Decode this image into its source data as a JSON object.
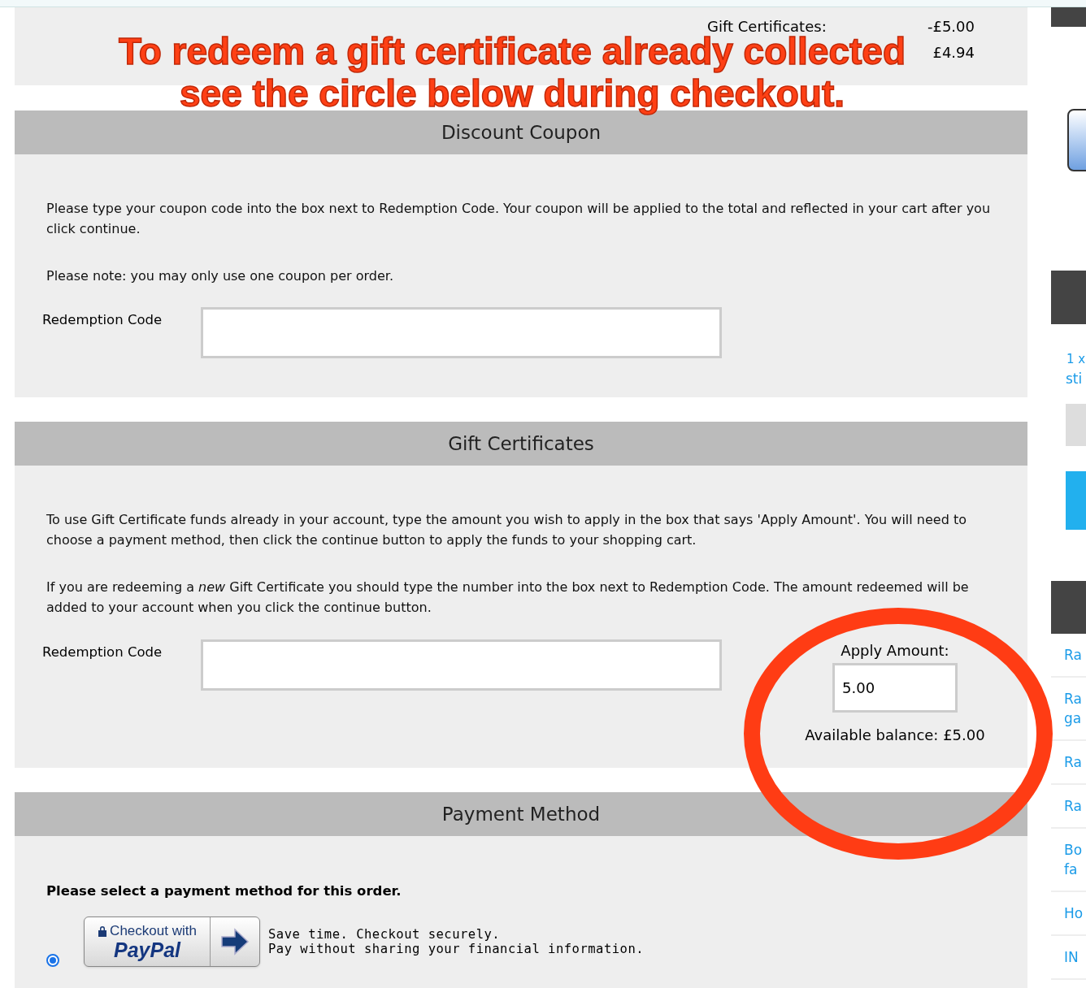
{
  "summary": [
    {
      "label": "Gift Certificates:",
      "value": "-£5.00"
    },
    {
      "value": "£4.94"
    }
  ],
  "annotation": {
    "lines": [
      "To redeem a gift certificate already collected",
      "see the circle below during checkout."
    ]
  },
  "coupon": {
    "title": "Discount Coupon",
    "paragraphs": [
      "Please type your coupon code into the box next to Redemption Code. Your coupon will be applied to the total and reflected in your cart after you click continue.",
      "Please note: you may only use one coupon per order."
    ],
    "field_label": "Redemption Code"
  },
  "gift": {
    "title": "Gift Certificates",
    "paragraphs": [
      "To use Gift Certificate funds already in your account, type the amount you wish to apply in the box that says 'Apply Amount'. You will need to choose a payment method, then click the continue button to apply the funds to your shopping cart.",
      "If you are redeeming a *new* Gift Certificate you should type the number into the box next to Redemption Code. The amount redeemed will be added to your account when you click the continue button."
    ],
    "field_label": "Redemption Code",
    "apply_label": "Apply Amount:",
    "apply_value": "5.00",
    "balance": "Available balance: £5.00"
  },
  "payment": {
    "title": "Payment Method",
    "prompt": "Please select a payment method for this order.",
    "options": [
      {
        "selected": true,
        "button_top": "Checkout with",
        "button_brand": "PayPal",
        "lines": [
          "Save time. Checkout securely.",
          "Pay without sharing your financial information."
        ]
      }
    ]
  },
  "sidebar": {
    "cart_qty": "1 x",
    "cart_item": "sti",
    "links": [
      "Ra",
      "Ra\nga",
      "Ra",
      "Ra",
      "Bo\nfa",
      "Ho",
      "IN"
    ]
  }
}
